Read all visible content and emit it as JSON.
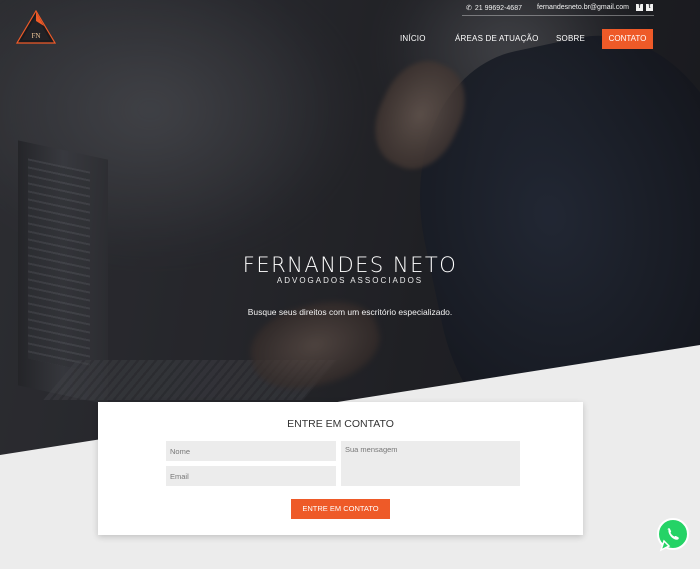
{
  "topbar": {
    "phone": "21 99692-4687",
    "email": "fernandesneto.br@gmail.com",
    "social": [
      "facebook-icon",
      "twitter-icon"
    ]
  },
  "logo": {
    "letters": "FN"
  },
  "nav": {
    "items": [
      "INÍCIO",
      "ÁREAS DE ATUAÇÃO",
      "SOBRE"
    ],
    "cta": "CONTATO"
  },
  "hero": {
    "name": "FERNANDES NETO",
    "subtitle": "ADVOGADOS ASSOCIADOS",
    "tagline": "Busque seus direitos com um escritório especializado."
  },
  "contact": {
    "title": "ENTRE EM CONTATO",
    "name_placeholder": "Nome",
    "email_placeholder": "Email",
    "message_placeholder": "Sua mensagem",
    "submit": "ENTRE EM CONTATO"
  },
  "colors": {
    "accent": "#ee5a28",
    "whatsapp": "#25d366"
  }
}
